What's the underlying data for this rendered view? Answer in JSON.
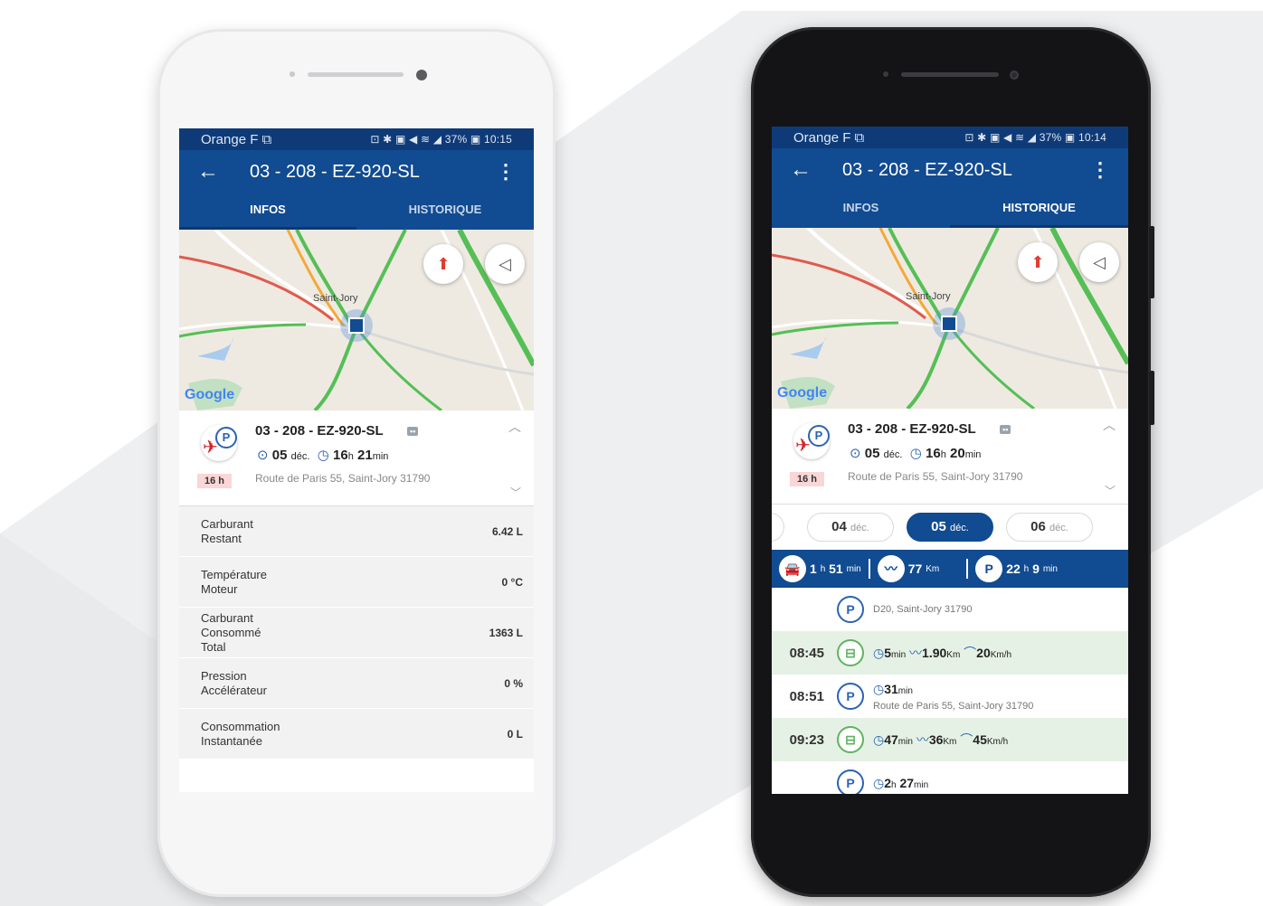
{
  "phone_left": {
    "status": {
      "carrier": "Orange F ⧉",
      "right": "⊡ ✱ ▣ ◀ ≋ ◢ 37% ▣ 10:15"
    },
    "appbar": {
      "back": "←",
      "title": "03 - 208 - EZ-920-SL",
      "more": "⋮"
    },
    "tabs": [
      {
        "label": "INFOS",
        "active": true
      },
      {
        "label": "HISTORIQUE",
        "active": false
      }
    ],
    "map": {
      "compass": "⬆",
      "locate": "◁",
      "attribution": "Google",
      "town": "Saint-Jory"
    },
    "card": {
      "name": "03 - 208 - EZ-920-SL",
      "badge": "▪▪",
      "date_num": "05",
      "date_month": "déc.",
      "dur_h": "16",
      "dur_h_unit": "h",
      "dur_m": "21",
      "dur_m_unit": "min",
      "hour_badge": "16 h",
      "address": "Route de Paris 55, Saint-Jory 31790"
    },
    "info_rows": [
      {
        "label": "Carburant\nRestant",
        "value": "6.42 L"
      },
      {
        "label": "Température\nMoteur",
        "value": "0 °C"
      },
      {
        "label": "Carburant\nConsommé\nTotal",
        "value": "1363 L"
      },
      {
        "label": "Pression\nAccélérateur",
        "value": "0 %"
      },
      {
        "label": "Consommation\nInstantanée",
        "value": "0 L"
      }
    ]
  },
  "phone_right": {
    "status": {
      "carrier": "Orange F ⧉",
      "right": "⊡ ✱ ▣ ◀ ≋ ◢ 37% ▣ 10:14"
    },
    "appbar": {
      "back": "←",
      "title": "03 - 208 - EZ-920-SL",
      "more": "⋮"
    },
    "tabs": [
      {
        "label": "INFOS",
        "active": false
      },
      {
        "label": "HISTORIQUE",
        "active": true
      }
    ],
    "map": {
      "compass": "⬆",
      "locate": "◁",
      "attribution": "Google",
      "town": "Saint-Jory"
    },
    "card": {
      "name": "03 - 208 - EZ-920-SL",
      "badge": "▪▪",
      "date_num": "05",
      "date_month": "déc.",
      "dur_h": "16",
      "dur_h_unit": "h",
      "dur_m": "20",
      "dur_m_unit": "min",
      "hour_badge": "16 h",
      "address": "Route de Paris 55, Saint-Jory 31790"
    },
    "dates": [
      {
        "num": "04",
        "month": "déc.",
        "active": false
      },
      {
        "num": "05",
        "month": "déc.",
        "active": true
      },
      {
        "num": "06",
        "month": "déc.",
        "active": false
      }
    ],
    "summary": {
      "drive_h": "1",
      "drive_h_unit": "h",
      "drive_m": "51",
      "drive_m_unit": "min",
      "dist": "77",
      "dist_unit": "Km",
      "park_h": "22",
      "park_h_unit": "h",
      "park_m": "9",
      "park_m_unit": "min",
      "park_letter": "P"
    },
    "timeline": [
      {
        "time": "",
        "kind": "park",
        "text": "D20, Saint-Jory 31790"
      },
      {
        "time": "08:45",
        "kind": "drive",
        "dur": "5",
        "dur_unit": "min",
        "dist": "1.90",
        "dist_unit": "Km",
        "speed": "20",
        "speed_unit": "Km/h"
      },
      {
        "time": "08:51",
        "kind": "park",
        "dur": "31",
        "dur_unit": "min",
        "text": "Route de Paris 55, Saint-Jory 31790"
      },
      {
        "time": "09:23",
        "kind": "drive",
        "dur": "47",
        "dur_unit": "min",
        "dist": "36",
        "dist_unit": "Km",
        "speed": "45",
        "speed_unit": "Km/h"
      },
      {
        "time": "",
        "kind": "park",
        "dur_h": "2",
        "dur_h_unit": "h",
        "dur": "27",
        "dur_unit": "min"
      }
    ]
  },
  "icons": {
    "clock": "◷",
    "calendar": "⊙",
    "route": "〰",
    "speed": "⌒",
    "car": "🚘",
    "park": "P"
  },
  "colors": {
    "primary": "#114b91",
    "statusbar": "#0e3b78",
    "drive_green": "#e5f1e4",
    "accent": "#2b63b4"
  }
}
